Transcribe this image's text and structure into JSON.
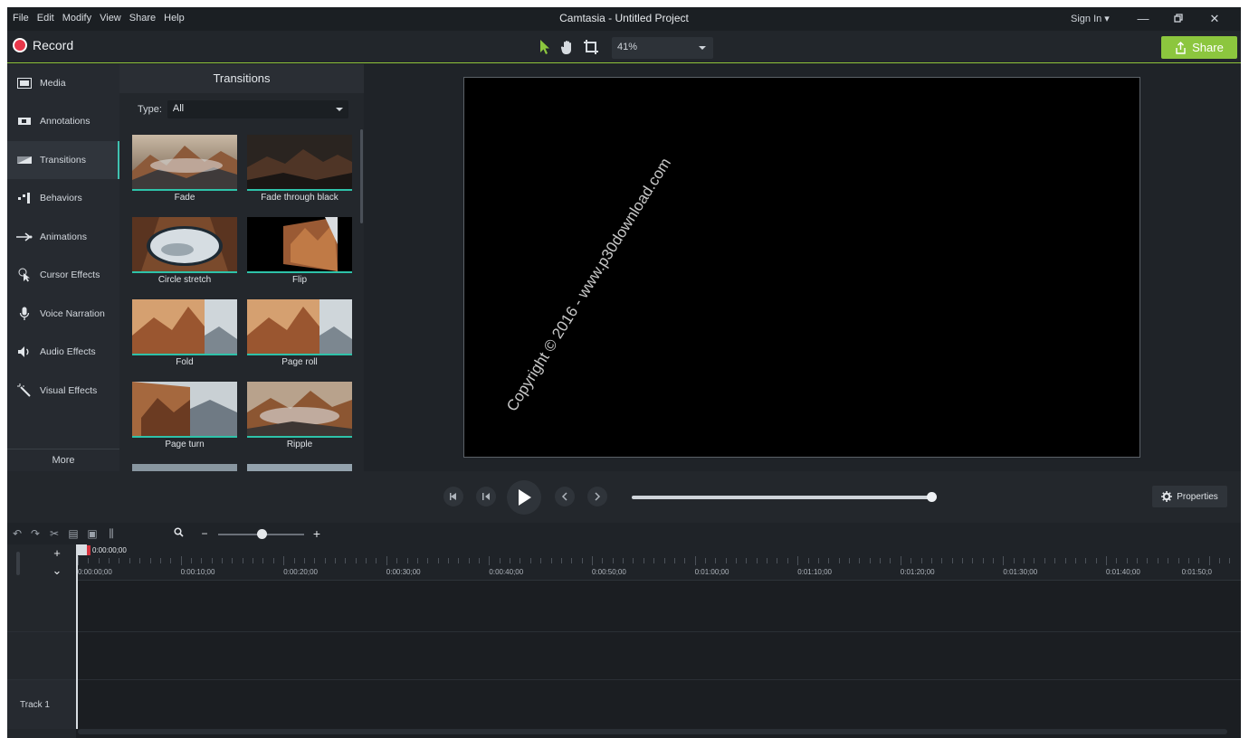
{
  "window": {
    "title": "Camtasia - Untitled Project",
    "menus": [
      "File",
      "Edit",
      "Modify",
      "View",
      "Share",
      "Help"
    ],
    "sign_in": "Sign In ▾",
    "minimize_icon": "minimize-icon",
    "maximize_icon": "restore-icon",
    "close_icon": "close-icon"
  },
  "toolbar": {
    "record_label": "Record",
    "zoom_value": "41%",
    "share_label": "Share",
    "accent_color": "#8cc63e",
    "record_color": "#e8374a",
    "tools": [
      "select-arrow-icon",
      "pan-hand-icon",
      "crop-icon"
    ]
  },
  "sidebar": {
    "items": [
      {
        "label": "Media",
        "icon": "film-strip-icon"
      },
      {
        "label": "Annotations",
        "icon": "annotation-icon"
      },
      {
        "label": "Transitions",
        "icon": "transition-icon"
      },
      {
        "label": "Behaviors",
        "icon": "behaviors-icon"
      },
      {
        "label": "Animations",
        "icon": "arrow-animation-icon"
      },
      {
        "label": "Cursor Effects",
        "icon": "cursor-icon"
      },
      {
        "label": "Voice Narration",
        "icon": "microphone-icon"
      },
      {
        "label": "Audio Effects",
        "icon": "speaker-icon"
      },
      {
        "label": "Visual Effects",
        "icon": "magic-wand-icon"
      }
    ],
    "active": "Transitions",
    "more_label": "More"
  },
  "transitions_panel": {
    "title": "Transitions",
    "type_label": "Type:",
    "type_value": "All",
    "accent_color": "#2ec2a9",
    "items": [
      {
        "label": "Fade"
      },
      {
        "label": "Fade through black"
      },
      {
        "label": "Circle stretch"
      },
      {
        "label": "Flip"
      },
      {
        "label": "Fold"
      },
      {
        "label": "Page roll"
      },
      {
        "label": "Page turn"
      },
      {
        "label": "Ripple"
      }
    ]
  },
  "canvas": {
    "watermark": "Copyright © 2016 - www.p30download.com"
  },
  "playback": {
    "properties_label": "Properties",
    "buttons": [
      "step-back-icon",
      "previous-frame-icon",
      "play-icon",
      "previous-marker-icon",
      "next-marker-icon"
    ],
    "progress": 1.0
  },
  "timeline": {
    "playhead_time": "0:00:00;00",
    "ticks": [
      "0:00:00;00",
      "0:00:10;00",
      "0:00:20;00",
      "0:00:30;00",
      "0:00:40;00",
      "0:00:50;00",
      "0:01:00;00",
      "0:01:10;00",
      "0:01:20;00",
      "0:01:30;00",
      "0:01:40;00",
      "0:01:50;0"
    ],
    "track_label": "Track 1",
    "add_track": "+",
    "collapse": "⌄",
    "zoom_level": 0.45
  }
}
